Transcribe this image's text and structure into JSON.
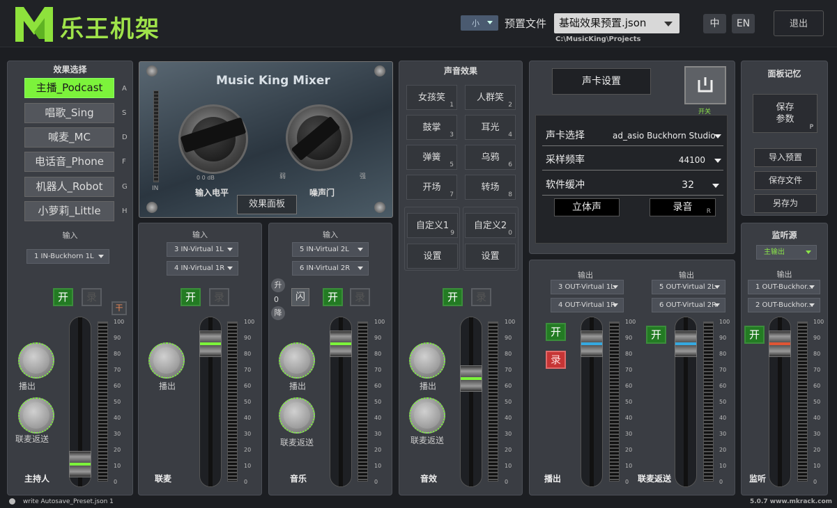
{
  "app": {
    "title": "乐王机架",
    "version_site": "5.0.7 www.mkrack.com"
  },
  "top": {
    "size_select": "小",
    "preset_label": "预置文件",
    "preset_file": "基础效果预置.json",
    "preset_path": "C:\\MusicKing\\Projects",
    "lang_cn": "中",
    "lang_en": "EN",
    "exit_label": "退出"
  },
  "effect_select": {
    "title": "效果选择",
    "items": [
      {
        "label": "主播_Podcast",
        "key": "A",
        "active": true
      },
      {
        "label": "唱歌_Sing",
        "key": "S"
      },
      {
        "label": "喊麦_MC",
        "key": "D"
      },
      {
        "label": "电话音_Phone",
        "key": "F"
      },
      {
        "label": "机器人_Robot",
        "key": "G"
      },
      {
        "label": "小萝莉_Little",
        "key": "H"
      }
    ]
  },
  "mixer_panel": {
    "title": "Music King Mixer",
    "input_level_label": "输入电平",
    "noise_gate_label": "噪声门",
    "weak_label": "弱",
    "strong_label": "强",
    "in_label": "IN",
    "db_label": "0 0 dB",
    "effects_panel_button": "效果面板"
  },
  "channels": {
    "host": {
      "input_label": "输入",
      "input": "1 IN-Buckhorn 1L",
      "on": "开",
      "rec": "录",
      "dry": "干",
      "knob1": "播出",
      "knob2": "联麦返送",
      "name": "主持人",
      "fader_level": 0.05
    },
    "guest": {
      "input_label": "输入",
      "input1": "3 IN-Virtual 1L",
      "input2": "4 IN-Virtual 1R",
      "on": "开",
      "rec": "录",
      "knob1": "播出",
      "name": "联麦",
      "fader_level": 0.92
    },
    "music": {
      "input_label": "输入",
      "input1": "5 IN-Virtual 2L",
      "input2": "6 IN-Virtual 2R",
      "up": "升",
      "zero": "0",
      "down": "降",
      "flash": "闪",
      "on": "开",
      "rec": "录",
      "knob1": "播出",
      "knob2": "联麦返送",
      "name": "音乐",
      "fader_level": 0.92
    },
    "sfx": {
      "title": "声音效果",
      "on": "开",
      "rec": "录",
      "knob1": "播出",
      "knob2": "联麦返送",
      "name": "音效",
      "fader_level": 0.67,
      "buttons": [
        {
          "label": "女孩笑",
          "key": "1"
        },
        {
          "label": "人群笑",
          "key": "2"
        },
        {
          "label": "鼓掌",
          "key": "3"
        },
        {
          "label": "耳光",
          "key": "4"
        },
        {
          "label": "弹簧",
          "key": "5"
        },
        {
          "label": "乌鸦",
          "key": "6"
        },
        {
          "label": "开场",
          "key": "7"
        },
        {
          "label": "转场",
          "key": "8"
        }
      ],
      "custom1": "自定义1",
      "custom1_key": "9",
      "custom2": "自定义2",
      "custom2_key": "0",
      "settings1": "设置",
      "settings2": "设置"
    }
  },
  "soundcard": {
    "button": "声卡设置",
    "power_label": "开关",
    "select_label": "声卡选择",
    "select_value": "ad_asio Buckhorn Studio",
    "rate_label": "采样频率",
    "rate_value": "44100",
    "buffer_label": "软件缓冲",
    "buffer_value": "32",
    "stereo": "立体声",
    "record": "录音",
    "record_key": "R"
  },
  "outputs": {
    "broadcast": {
      "output_label": "输出",
      "out1": "3 OUT-Virtual 1L",
      "out2": "4 OUT-Virtual 1R",
      "on": "开",
      "rec": "录",
      "name": "播出"
    },
    "return": {
      "output_label": "输出",
      "out1": "5 OUT-Virtual 2L",
      "out2": "6 OUT-Virtual 2R",
      "on": "开",
      "name": "联麦返送"
    }
  },
  "panel_memory": {
    "title": "面板记忆",
    "save": "保存\n参数",
    "save_key": "P",
    "import": "导入预置",
    "save_file": "保存文件",
    "save_as": "另存为"
  },
  "monitor": {
    "title": "监听源",
    "source": "主输出",
    "output_label": "输出",
    "out1": "1 OUT-Buckhor...",
    "out2": "2 OUT-Buckhor...",
    "on": "开",
    "name": "监听"
  },
  "status": {
    "message": "write Autosave_Preset.json 1"
  },
  "scale": [
    "100",
    "90",
    "80",
    "70",
    "60",
    "50",
    "40",
    "30",
    "20",
    "10",
    "0"
  ]
}
